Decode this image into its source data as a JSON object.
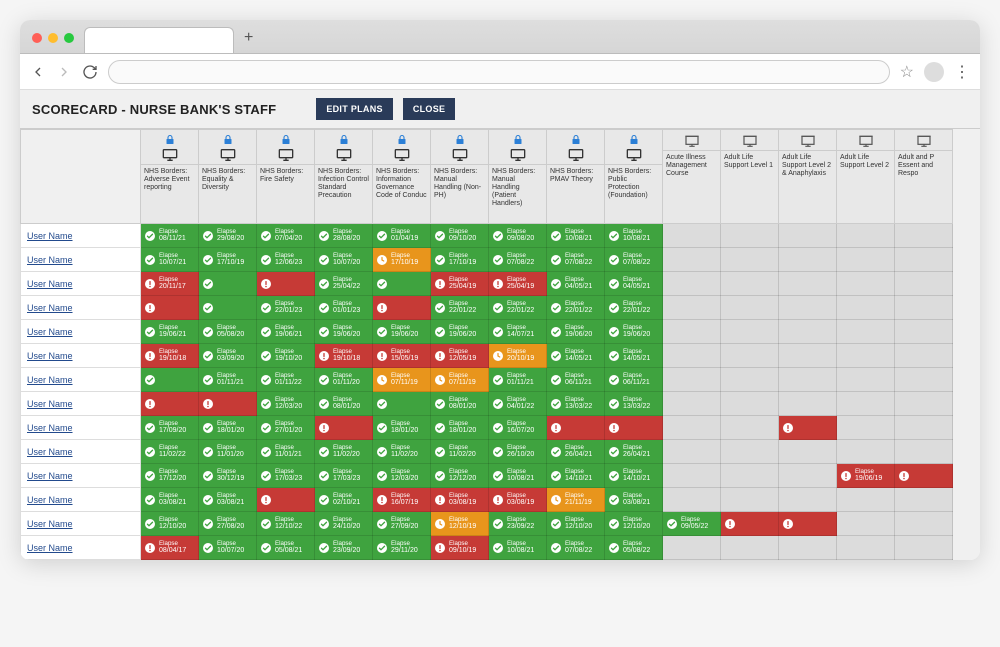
{
  "header": {
    "title": "SCORECARD - NURSE BANK'S STAFF",
    "edit_plans": "EDIT PLANS",
    "close": "CLOSE"
  },
  "columns": [
    {
      "label": "NHS Borders: Adverse Event reporting",
      "locked": true,
      "projector": false
    },
    {
      "label": "NHS Borders: Equality & Diversity",
      "locked": true,
      "projector": false
    },
    {
      "label": "NHS Borders: Fire Safety",
      "locked": true,
      "projector": false
    },
    {
      "label": "NHS Borders: Infection Control Standard Precaution",
      "locked": true,
      "projector": false
    },
    {
      "label": "NHS Borders: Information Governance Code of Conduc",
      "locked": true,
      "projector": false
    },
    {
      "label": "NHS Borders: Manual Handling (Non-PH)",
      "locked": true,
      "projector": false
    },
    {
      "label": "NHS Borders: Manual Handling (Patient Handlers)",
      "locked": true,
      "projector": false
    },
    {
      "label": "NHS Borders: PMAV Theory",
      "locked": true,
      "projector": false
    },
    {
      "label": "NHS Borders: Public Protection (Foundation)",
      "locked": true,
      "projector": false
    },
    {
      "label": "Acute Illness Management Course",
      "locked": false,
      "projector": true
    },
    {
      "label": "Adult Life Support Level 1",
      "locked": false,
      "projector": true
    },
    {
      "label": "Adult Life Support Level 2 & Anaphylaxis",
      "locked": false,
      "projector": true
    },
    {
      "label": "Adult Life Support Level 2",
      "locked": false,
      "projector": true
    },
    {
      "label": "Adult and P Essent and Respo",
      "locked": false,
      "projector": true
    }
  ],
  "cell_label": "Elapse",
  "rows": [
    {
      "user": "User Name",
      "cells": [
        {
          "s": "ok",
          "d": "08/11/21"
        },
        {
          "s": "ok",
          "d": "29/08/20"
        },
        {
          "s": "ok",
          "d": "07/04/20"
        },
        {
          "s": "ok",
          "d": "28/08/20"
        },
        {
          "s": "ok",
          "d": "01/04/19"
        },
        {
          "s": "ok",
          "d": "09/10/20"
        },
        {
          "s": "ok",
          "d": "09/08/20"
        },
        {
          "s": "ok",
          "d": "10/08/21"
        },
        {
          "s": "ok",
          "d": "10/08/21"
        },
        {
          "s": "empty"
        },
        {
          "s": "empty"
        },
        {
          "s": "empty"
        },
        {
          "s": "empty"
        },
        {
          "s": "empty"
        }
      ]
    },
    {
      "user": "User Name",
      "cells": [
        {
          "s": "ok",
          "d": "10/07/21"
        },
        {
          "s": "ok",
          "d": "17/10/19"
        },
        {
          "s": "ok",
          "d": "12/06/23"
        },
        {
          "s": "ok",
          "d": "10/07/20"
        },
        {
          "s": "warn",
          "d": "17/10/19"
        },
        {
          "s": "ok",
          "d": "17/10/19"
        },
        {
          "s": "ok",
          "d": "07/08/22"
        },
        {
          "s": "ok",
          "d": "07/08/22"
        },
        {
          "s": "ok",
          "d": "07/08/22"
        },
        {
          "s": "empty"
        },
        {
          "s": "empty"
        },
        {
          "s": "empty"
        },
        {
          "s": "empty"
        },
        {
          "s": "empty"
        }
      ]
    },
    {
      "user": "User Name",
      "cells": [
        {
          "s": "bad",
          "d": "20/11/17"
        },
        {
          "s": "ok",
          "d": ""
        },
        {
          "s": "bad",
          "d": ""
        },
        {
          "s": "ok",
          "d": "25/04/22"
        },
        {
          "s": "ok",
          "d": ""
        },
        {
          "s": "bad",
          "d": "25/04/19"
        },
        {
          "s": "bad",
          "d": "25/04/19"
        },
        {
          "s": "ok",
          "d": "04/05/21"
        },
        {
          "s": "ok",
          "d": "04/05/21"
        },
        {
          "s": "empty"
        },
        {
          "s": "empty"
        },
        {
          "s": "empty"
        },
        {
          "s": "empty"
        },
        {
          "s": "empty"
        }
      ]
    },
    {
      "user": "User Name",
      "cells": [
        {
          "s": "bad",
          "d": ""
        },
        {
          "s": "ok",
          "d": ""
        },
        {
          "s": "ok",
          "d": "22/01/23"
        },
        {
          "s": "ok",
          "d": "01/01/23"
        },
        {
          "s": "bad",
          "d": ""
        },
        {
          "s": "ok",
          "d": "22/01/22"
        },
        {
          "s": "ok",
          "d": "22/01/22"
        },
        {
          "s": "ok",
          "d": "22/01/22"
        },
        {
          "s": "ok",
          "d": "22/01/22"
        },
        {
          "s": "empty"
        },
        {
          "s": "empty"
        },
        {
          "s": "empty"
        },
        {
          "s": "empty"
        },
        {
          "s": "empty"
        }
      ]
    },
    {
      "user": "User Name",
      "cells": [
        {
          "s": "ok",
          "d": "19/06/21"
        },
        {
          "s": "ok",
          "d": "05/08/20"
        },
        {
          "s": "ok",
          "d": "19/06/21"
        },
        {
          "s": "ok",
          "d": "19/06/20"
        },
        {
          "s": "ok",
          "d": "19/06/20"
        },
        {
          "s": "ok",
          "d": "19/06/20"
        },
        {
          "s": "ok",
          "d": "14/07/21"
        },
        {
          "s": "ok",
          "d": "19/06/20"
        },
        {
          "s": "ok",
          "d": "19/06/20"
        },
        {
          "s": "empty"
        },
        {
          "s": "empty"
        },
        {
          "s": "empty"
        },
        {
          "s": "empty"
        },
        {
          "s": "empty"
        }
      ]
    },
    {
      "user": "User Name",
      "cells": [
        {
          "s": "bad",
          "d": "19/10/18"
        },
        {
          "s": "ok",
          "d": "03/09/20"
        },
        {
          "s": "ok",
          "d": "19/10/20"
        },
        {
          "s": "bad",
          "d": "19/10/18"
        },
        {
          "s": "bad",
          "d": "15/05/19"
        },
        {
          "s": "bad",
          "d": "12/05/19"
        },
        {
          "s": "warn",
          "d": "20/10/19"
        },
        {
          "s": "ok",
          "d": "14/05/21"
        },
        {
          "s": "ok",
          "d": "14/05/21"
        },
        {
          "s": "empty"
        },
        {
          "s": "empty"
        },
        {
          "s": "empty"
        },
        {
          "s": "empty"
        },
        {
          "s": "empty"
        }
      ]
    },
    {
      "user": "User Name",
      "cells": [
        {
          "s": "ok",
          "d": ""
        },
        {
          "s": "ok",
          "d": "01/11/21"
        },
        {
          "s": "ok",
          "d": "01/11/22"
        },
        {
          "s": "ok",
          "d": "01/11/20"
        },
        {
          "s": "warn",
          "d": "07/11/19"
        },
        {
          "s": "warn",
          "d": "07/11/19"
        },
        {
          "s": "ok",
          "d": "01/11/21"
        },
        {
          "s": "ok",
          "d": "06/11/21"
        },
        {
          "s": "ok",
          "d": "06/11/21"
        },
        {
          "s": "empty"
        },
        {
          "s": "empty"
        },
        {
          "s": "empty"
        },
        {
          "s": "empty"
        },
        {
          "s": "empty"
        }
      ]
    },
    {
      "user": "User Name",
      "cells": [
        {
          "s": "bad",
          "d": ""
        },
        {
          "s": "bad",
          "d": ""
        },
        {
          "s": "ok",
          "d": "12/03/20"
        },
        {
          "s": "ok",
          "d": "08/01/20"
        },
        {
          "s": "ok",
          "d": ""
        },
        {
          "s": "ok",
          "d": "08/01/20"
        },
        {
          "s": "ok",
          "d": "04/01/22"
        },
        {
          "s": "ok",
          "d": "13/03/22"
        },
        {
          "s": "ok",
          "d": "13/03/22"
        },
        {
          "s": "empty"
        },
        {
          "s": "empty"
        },
        {
          "s": "empty"
        },
        {
          "s": "empty"
        },
        {
          "s": "empty"
        }
      ]
    },
    {
      "user": "User Name",
      "cells": [
        {
          "s": "ok",
          "d": "17/09/20"
        },
        {
          "s": "ok",
          "d": "18/01/20"
        },
        {
          "s": "ok",
          "d": "27/01/20"
        },
        {
          "s": "bad",
          "d": ""
        },
        {
          "s": "ok",
          "d": "18/01/20"
        },
        {
          "s": "ok",
          "d": "18/01/20"
        },
        {
          "s": "ok",
          "d": "16/07/20"
        },
        {
          "s": "bad",
          "d": ""
        },
        {
          "s": "bad",
          "d": ""
        },
        {
          "s": "empty"
        },
        {
          "s": "empty"
        },
        {
          "s": "bad",
          "d": ""
        },
        {
          "s": "empty"
        },
        {
          "s": "empty"
        }
      ]
    },
    {
      "user": "User Name",
      "cells": [
        {
          "s": "ok",
          "d": "11/02/22"
        },
        {
          "s": "ok",
          "d": "11/01/20"
        },
        {
          "s": "ok",
          "d": "11/01/21"
        },
        {
          "s": "ok",
          "d": "11/02/20"
        },
        {
          "s": "ok",
          "d": "11/02/20"
        },
        {
          "s": "ok",
          "d": "11/02/20"
        },
        {
          "s": "ok",
          "d": "26/10/20"
        },
        {
          "s": "ok",
          "d": "26/04/21"
        },
        {
          "s": "ok",
          "d": "26/04/21"
        },
        {
          "s": "empty"
        },
        {
          "s": "empty"
        },
        {
          "s": "empty"
        },
        {
          "s": "empty"
        },
        {
          "s": "empty"
        }
      ]
    },
    {
      "user": "User Name",
      "cells": [
        {
          "s": "ok",
          "d": "17/12/20"
        },
        {
          "s": "ok",
          "d": "30/12/19"
        },
        {
          "s": "ok",
          "d": "17/03/23"
        },
        {
          "s": "ok",
          "d": "17/03/23"
        },
        {
          "s": "ok",
          "d": "12/03/20"
        },
        {
          "s": "ok",
          "d": "12/12/20"
        },
        {
          "s": "ok",
          "d": "10/08/21"
        },
        {
          "s": "ok",
          "d": "14/10/21"
        },
        {
          "s": "ok",
          "d": "14/10/21"
        },
        {
          "s": "empty"
        },
        {
          "s": "empty"
        },
        {
          "s": "empty"
        },
        {
          "s": "bad",
          "d": "19/06/19"
        },
        {
          "s": "bad",
          "d": ""
        }
      ]
    },
    {
      "user": "User Name",
      "cells": [
        {
          "s": "ok",
          "d": "03/08/21"
        },
        {
          "s": "ok",
          "d": "03/08/21"
        },
        {
          "s": "bad",
          "d": ""
        },
        {
          "s": "ok",
          "d": "02/10/21"
        },
        {
          "s": "bad",
          "d": "16/07/19"
        },
        {
          "s": "bad",
          "d": "03/08/19"
        },
        {
          "s": "bad",
          "d": "03/08/19"
        },
        {
          "s": "warn",
          "d": "21/11/19"
        },
        {
          "s": "ok",
          "d": "03/08/21"
        },
        {
          "s": "empty"
        },
        {
          "s": "empty"
        },
        {
          "s": "empty"
        },
        {
          "s": "empty"
        },
        {
          "s": "empty"
        }
      ]
    },
    {
      "user": "User Name",
      "cells": [
        {
          "s": "ok",
          "d": "12/10/20"
        },
        {
          "s": "ok",
          "d": "27/08/20"
        },
        {
          "s": "ok",
          "d": "12/10/22"
        },
        {
          "s": "ok",
          "d": "24/10/20"
        },
        {
          "s": "ok",
          "d": "27/09/20"
        },
        {
          "s": "warn",
          "d": "12/10/19"
        },
        {
          "s": "ok",
          "d": "23/09/22"
        },
        {
          "s": "ok",
          "d": "12/10/20"
        },
        {
          "s": "ok",
          "d": "12/10/20"
        },
        {
          "s": "ok",
          "d": "09/05/22"
        },
        {
          "s": "bad",
          "d": ""
        },
        {
          "s": "bad",
          "d": ""
        },
        {
          "s": "empty"
        },
        {
          "s": "empty"
        }
      ]
    },
    {
      "user": "User Name",
      "cells": [
        {
          "s": "bad",
          "d": "08/04/17"
        },
        {
          "s": "ok",
          "d": "10/07/20"
        },
        {
          "s": "ok",
          "d": "05/08/21"
        },
        {
          "s": "ok",
          "d": "23/09/20"
        },
        {
          "s": "ok",
          "d": "29/11/20"
        },
        {
          "s": "bad",
          "d": "09/10/19"
        },
        {
          "s": "ok",
          "d": "10/08/21"
        },
        {
          "s": "ok",
          "d": "07/08/22"
        },
        {
          "s": "ok",
          "d": "05/08/22"
        },
        {
          "s": "empty"
        },
        {
          "s": "empty"
        },
        {
          "s": "empty"
        },
        {
          "s": "empty"
        },
        {
          "s": "empty"
        }
      ]
    }
  ]
}
